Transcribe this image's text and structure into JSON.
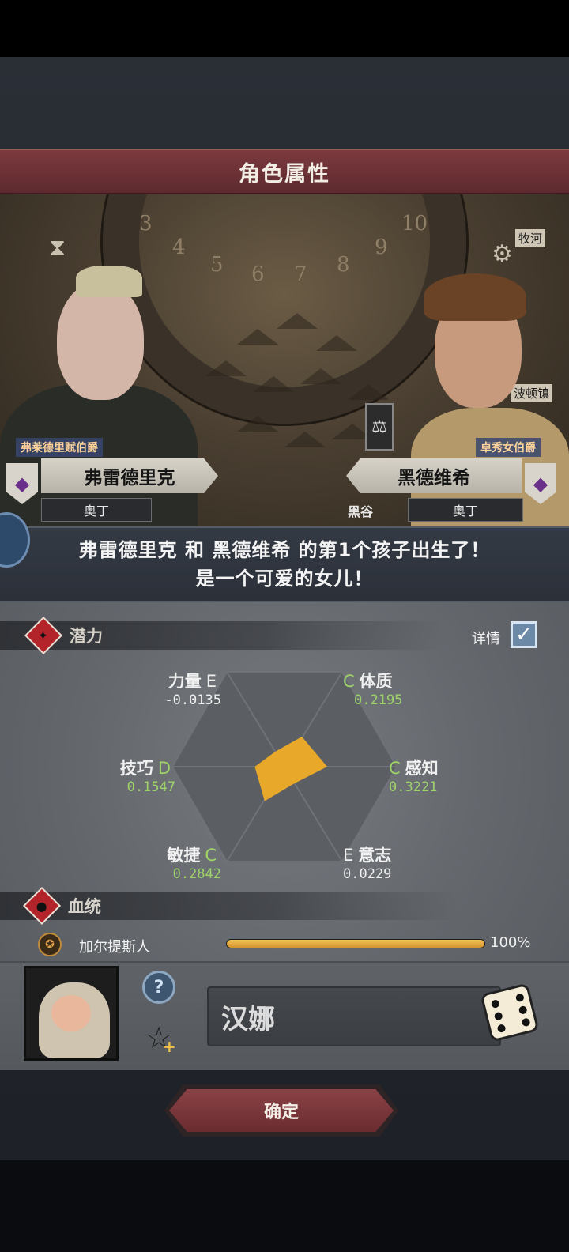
{
  "title": "角色属性",
  "father": {
    "title": "弗莱德里赋伯爵",
    "name": "弗雷德里克",
    "family": "奥丁"
  },
  "mother": {
    "title": "卓秀女伯爵",
    "name": "黑德维希",
    "family": "奥丁"
  },
  "scene": {
    "dial_numbers": [
      "3",
      "4",
      "5",
      "6",
      "7",
      "8",
      "9",
      "10"
    ],
    "place_label": "黑谷",
    "map_labels": [
      "牧河",
      "波顿镇"
    ]
  },
  "message": {
    "line1": "弗雷德里克 和 黑德维希 的第1个孩子出生了！",
    "line2": "是一个可爱的女儿！"
  },
  "potential": {
    "section_title": "潜力",
    "detail_label": "详情",
    "detail_checked": true,
    "stats": [
      {
        "name": "力量",
        "grade": "E",
        "value": "-0.0135"
      },
      {
        "name": "体质",
        "grade": "C",
        "value": "0.2195"
      },
      {
        "name": "感知",
        "grade": "C",
        "value": "0.3221"
      },
      {
        "name": "意志",
        "grade": "E",
        "value": "0.0229"
      },
      {
        "name": "敏捷",
        "grade": "C",
        "value": "0.2842"
      },
      {
        "name": "技巧",
        "grade": "D",
        "value": "0.1547"
      }
    ]
  },
  "bloodline": {
    "section_title": "血统",
    "items": [
      {
        "name": "加尔提斯人",
        "percent_label": "100%",
        "percent": 1.0
      }
    ]
  },
  "child": {
    "name_value": "汉娜"
  },
  "confirm_label": "确定",
  "colors": {
    "title_bar": "#7c3a3e",
    "grade_green": "#9ed36a",
    "radar_fill": "#e8a82a",
    "bloodline_bar": "#f0b84c"
  }
}
